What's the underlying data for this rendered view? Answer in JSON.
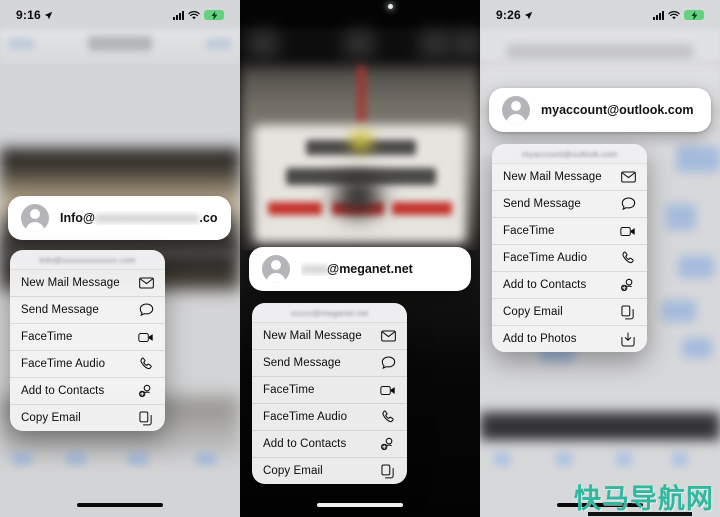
{
  "menu": {
    "items": [
      {
        "label": "New Mail Message",
        "icon": "envelope-icon"
      },
      {
        "label": "Send Message",
        "icon": "speech-bubble-icon"
      },
      {
        "label": "FaceTime",
        "icon": "video-camera-icon"
      },
      {
        "label": "FaceTime Audio",
        "icon": "phone-handset-icon"
      },
      {
        "label": "Add to Contacts",
        "icon": "add-person-icon"
      },
      {
        "label": "Copy Email",
        "icon": "copy-documents-icon"
      },
      {
        "label": "Add to Photos",
        "icon": "save-download-icon"
      }
    ]
  },
  "panels": [
    {
      "id": "panel-left",
      "theme": "light",
      "status": {
        "time": "9:16",
        "location_icon": "location-arrow-icon",
        "cellular_icon": "cellular-bars-icon",
        "wifi_icon": "wifi-icon",
        "battery_icon": "battery-charging-icon"
      },
      "card": {
        "email_prefix": "Info@",
        "email_blurred": "xxxxxxxxxxxxxxx",
        "email_suffix": ".com",
        "avatar": "contact-avatar"
      },
      "menu_header": "Info@xxxxxxxxxxxxx.com",
      "menu_item_count": 6,
      "home_indicator": "dark-bar"
    },
    {
      "id": "panel-middle",
      "theme": "dark",
      "status": {
        "time": "",
        "location_icon": "",
        "cellular_icon": "",
        "wifi_icon": "",
        "battery_icon": ""
      },
      "card": {
        "email_prefix": "",
        "email_blurred": "xxxx",
        "email_suffix": "@meganet.net",
        "avatar": "contact-avatar"
      },
      "menu_header": "xxxxx@meganet.net",
      "menu_item_count": 6,
      "home_indicator": "light-bar"
    },
    {
      "id": "panel-right",
      "theme": "light",
      "status": {
        "time": "9:26",
        "location_icon": "location-arrow-icon",
        "cellular_icon": "cellular-bars-icon",
        "wifi_icon": "wifi-icon",
        "battery_icon": "battery-charging-icon"
      },
      "card": {
        "email_prefix": "myaccount@outlook.com",
        "email_blurred": "",
        "email_suffix": "",
        "avatar": "contact-avatar"
      },
      "menu_header": "myaccount@outlook.com",
      "menu_item_count": 7,
      "home_indicator": "dark-bar"
    }
  ],
  "watermark": {
    "text": "快马导航网",
    "color": "#2fb8a0"
  }
}
